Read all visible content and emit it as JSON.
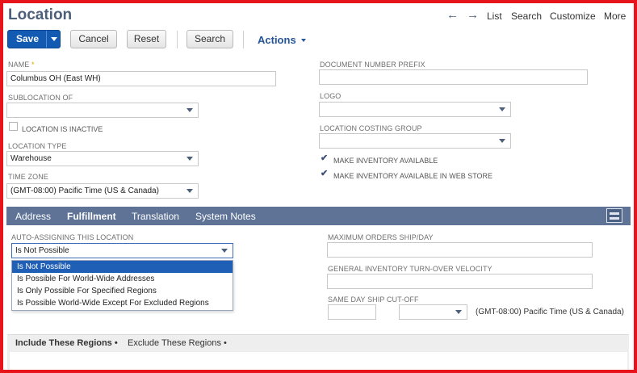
{
  "page": {
    "title": "Location"
  },
  "topnav": {
    "back_icon": "arrow-left-icon",
    "forward_icon": "arrow-right-icon",
    "list": "List",
    "search": "Search",
    "customize": "Customize",
    "more": "More"
  },
  "toolbar": {
    "save": "Save",
    "save_menu_icon": "caret-down-icon",
    "cancel": "Cancel",
    "reset": "Reset",
    "search": "Search",
    "actions": "Actions"
  },
  "form": {
    "name": {
      "label": "NAME",
      "required_mark": "*",
      "value": "Columbus OH (East WH)"
    },
    "sublocation": {
      "label": "SUBLOCATION OF",
      "value": ""
    },
    "inactive": {
      "label": "LOCATION IS INACTIVE",
      "checked": false
    },
    "location_type": {
      "label": "LOCATION TYPE",
      "value": "Warehouse"
    },
    "time_zone": {
      "label": "TIME ZONE",
      "value": "(GMT-08:00) Pacific Time (US & Canada)"
    },
    "doc_prefix": {
      "label": "DOCUMENT NUMBER PREFIX",
      "value": ""
    },
    "logo": {
      "label": "LOGO",
      "value": ""
    },
    "costing_group": {
      "label": "LOCATION COSTING GROUP",
      "value": ""
    },
    "make_inventory": {
      "label": "MAKE INVENTORY AVAILABLE",
      "checked": true
    },
    "make_inventory_web": {
      "label": "MAKE INVENTORY AVAILABLE IN WEB STORE",
      "checked": true
    }
  },
  "tabs": [
    {
      "label": "Address",
      "active": false
    },
    {
      "label": "Fulfillment",
      "active": true
    },
    {
      "label": "Translation",
      "active": false
    },
    {
      "label": "System Notes",
      "active": false
    }
  ],
  "fulfillment": {
    "auto_assign": {
      "label": "AUTO-ASSIGNING THIS LOCATION",
      "value": "Is Not Possible",
      "options": [
        "Is Not Possible",
        "Is Possible For World-Wide Addresses",
        "Is Only Possible For Specified Regions",
        "Is Possible World-Wide Except For Excluded Regions"
      ],
      "selected_index": 0
    },
    "max_orders": {
      "label": "MAXIMUM ORDERS SHIP/DAY",
      "value": ""
    },
    "turnover": {
      "label": "GENERAL INVENTORY TURN-OVER VELOCITY",
      "value": ""
    },
    "cutoff": {
      "label": "SAME DAY SHIP CUT-OFF",
      "time": "",
      "ampm": "",
      "tz": "(GMT-08:00) Pacific Time (US & Canada)"
    }
  },
  "subtabs": [
    {
      "label": "Include These Regions",
      "active": true
    },
    {
      "label": "Exclude These Regions",
      "active": false
    }
  ],
  "colors": {
    "brand": "#4d5f79",
    "primary": "#125ab2",
    "tabbar": "#5e7396",
    "selected_option": "#1f5fb5",
    "frame": "#e8141b"
  }
}
